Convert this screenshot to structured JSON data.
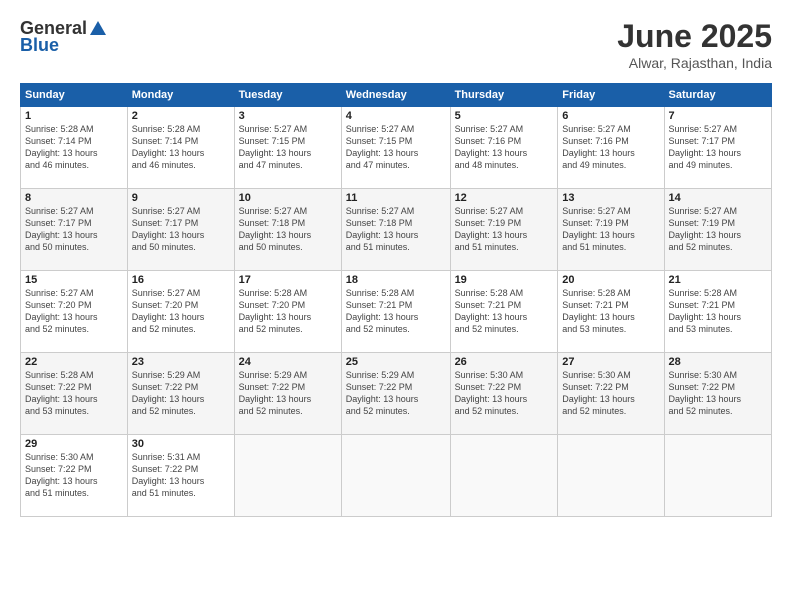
{
  "header": {
    "logo_general": "General",
    "logo_blue": "Blue",
    "title": "June 2025",
    "location": "Alwar, Rajasthan, India"
  },
  "columns": [
    "Sunday",
    "Monday",
    "Tuesday",
    "Wednesday",
    "Thursday",
    "Friday",
    "Saturday"
  ],
  "rows": [
    [
      {
        "day": "",
        "detail": ""
      },
      {
        "day": "2",
        "detail": "Sunrise: 5:28 AM\nSunset: 7:14 PM\nDaylight: 13 hours\nand 46 minutes."
      },
      {
        "day": "3",
        "detail": "Sunrise: 5:27 AM\nSunset: 7:15 PM\nDaylight: 13 hours\nand 47 minutes."
      },
      {
        "day": "4",
        "detail": "Sunrise: 5:27 AM\nSunset: 7:15 PM\nDaylight: 13 hours\nand 47 minutes."
      },
      {
        "day": "5",
        "detail": "Sunrise: 5:27 AM\nSunset: 7:16 PM\nDaylight: 13 hours\nand 48 minutes."
      },
      {
        "day": "6",
        "detail": "Sunrise: 5:27 AM\nSunset: 7:16 PM\nDaylight: 13 hours\nand 49 minutes."
      },
      {
        "day": "7",
        "detail": "Sunrise: 5:27 AM\nSunset: 7:17 PM\nDaylight: 13 hours\nand 49 minutes."
      }
    ],
    [
      {
        "day": "1",
        "detail": "Sunrise: 5:28 AM\nSunset: 7:14 PM\nDaylight: 13 hours\nand 46 minutes."
      },
      {
        "day": "",
        "detail": ""
      },
      {
        "day": "",
        "detail": ""
      },
      {
        "day": "",
        "detail": ""
      },
      {
        "day": "",
        "detail": ""
      },
      {
        "day": "",
        "detail": ""
      },
      {
        "day": "",
        "detail": ""
      }
    ],
    [
      {
        "day": "8",
        "detail": "Sunrise: 5:27 AM\nSunset: 7:17 PM\nDaylight: 13 hours\nand 50 minutes."
      },
      {
        "day": "9",
        "detail": "Sunrise: 5:27 AM\nSunset: 7:17 PM\nDaylight: 13 hours\nand 50 minutes."
      },
      {
        "day": "10",
        "detail": "Sunrise: 5:27 AM\nSunset: 7:18 PM\nDaylight: 13 hours\nand 50 minutes."
      },
      {
        "day": "11",
        "detail": "Sunrise: 5:27 AM\nSunset: 7:18 PM\nDaylight: 13 hours\nand 51 minutes."
      },
      {
        "day": "12",
        "detail": "Sunrise: 5:27 AM\nSunset: 7:19 PM\nDaylight: 13 hours\nand 51 minutes."
      },
      {
        "day": "13",
        "detail": "Sunrise: 5:27 AM\nSunset: 7:19 PM\nDaylight: 13 hours\nand 51 minutes."
      },
      {
        "day": "14",
        "detail": "Sunrise: 5:27 AM\nSunset: 7:19 PM\nDaylight: 13 hours\nand 52 minutes."
      }
    ],
    [
      {
        "day": "15",
        "detail": "Sunrise: 5:27 AM\nSunset: 7:20 PM\nDaylight: 13 hours\nand 52 minutes."
      },
      {
        "day": "16",
        "detail": "Sunrise: 5:27 AM\nSunset: 7:20 PM\nDaylight: 13 hours\nand 52 minutes."
      },
      {
        "day": "17",
        "detail": "Sunrise: 5:28 AM\nSunset: 7:20 PM\nDaylight: 13 hours\nand 52 minutes."
      },
      {
        "day": "18",
        "detail": "Sunrise: 5:28 AM\nSunset: 7:21 PM\nDaylight: 13 hours\nand 52 minutes."
      },
      {
        "day": "19",
        "detail": "Sunrise: 5:28 AM\nSunset: 7:21 PM\nDaylight: 13 hours\nand 52 minutes."
      },
      {
        "day": "20",
        "detail": "Sunrise: 5:28 AM\nSunset: 7:21 PM\nDaylight: 13 hours\nand 53 minutes."
      },
      {
        "day": "21",
        "detail": "Sunrise: 5:28 AM\nSunset: 7:21 PM\nDaylight: 13 hours\nand 53 minutes."
      }
    ],
    [
      {
        "day": "22",
        "detail": "Sunrise: 5:28 AM\nSunset: 7:22 PM\nDaylight: 13 hours\nand 53 minutes."
      },
      {
        "day": "23",
        "detail": "Sunrise: 5:29 AM\nSunset: 7:22 PM\nDaylight: 13 hours\nand 52 minutes."
      },
      {
        "day": "24",
        "detail": "Sunrise: 5:29 AM\nSunset: 7:22 PM\nDaylight: 13 hours\nand 52 minutes."
      },
      {
        "day": "25",
        "detail": "Sunrise: 5:29 AM\nSunset: 7:22 PM\nDaylight: 13 hours\nand 52 minutes."
      },
      {
        "day": "26",
        "detail": "Sunrise: 5:30 AM\nSunset: 7:22 PM\nDaylight: 13 hours\nand 52 minutes."
      },
      {
        "day": "27",
        "detail": "Sunrise: 5:30 AM\nSunset: 7:22 PM\nDaylight: 13 hours\nand 52 minutes."
      },
      {
        "day": "28",
        "detail": "Sunrise: 5:30 AM\nSunset: 7:22 PM\nDaylight: 13 hours\nand 52 minutes."
      }
    ],
    [
      {
        "day": "29",
        "detail": "Sunrise: 5:30 AM\nSunset: 7:22 PM\nDaylight: 13 hours\nand 51 minutes."
      },
      {
        "day": "30",
        "detail": "Sunrise: 5:31 AM\nSunset: 7:22 PM\nDaylight: 13 hours\nand 51 minutes."
      },
      {
        "day": "",
        "detail": ""
      },
      {
        "day": "",
        "detail": ""
      },
      {
        "day": "",
        "detail": ""
      },
      {
        "day": "",
        "detail": ""
      },
      {
        "day": "",
        "detail": ""
      }
    ]
  ]
}
